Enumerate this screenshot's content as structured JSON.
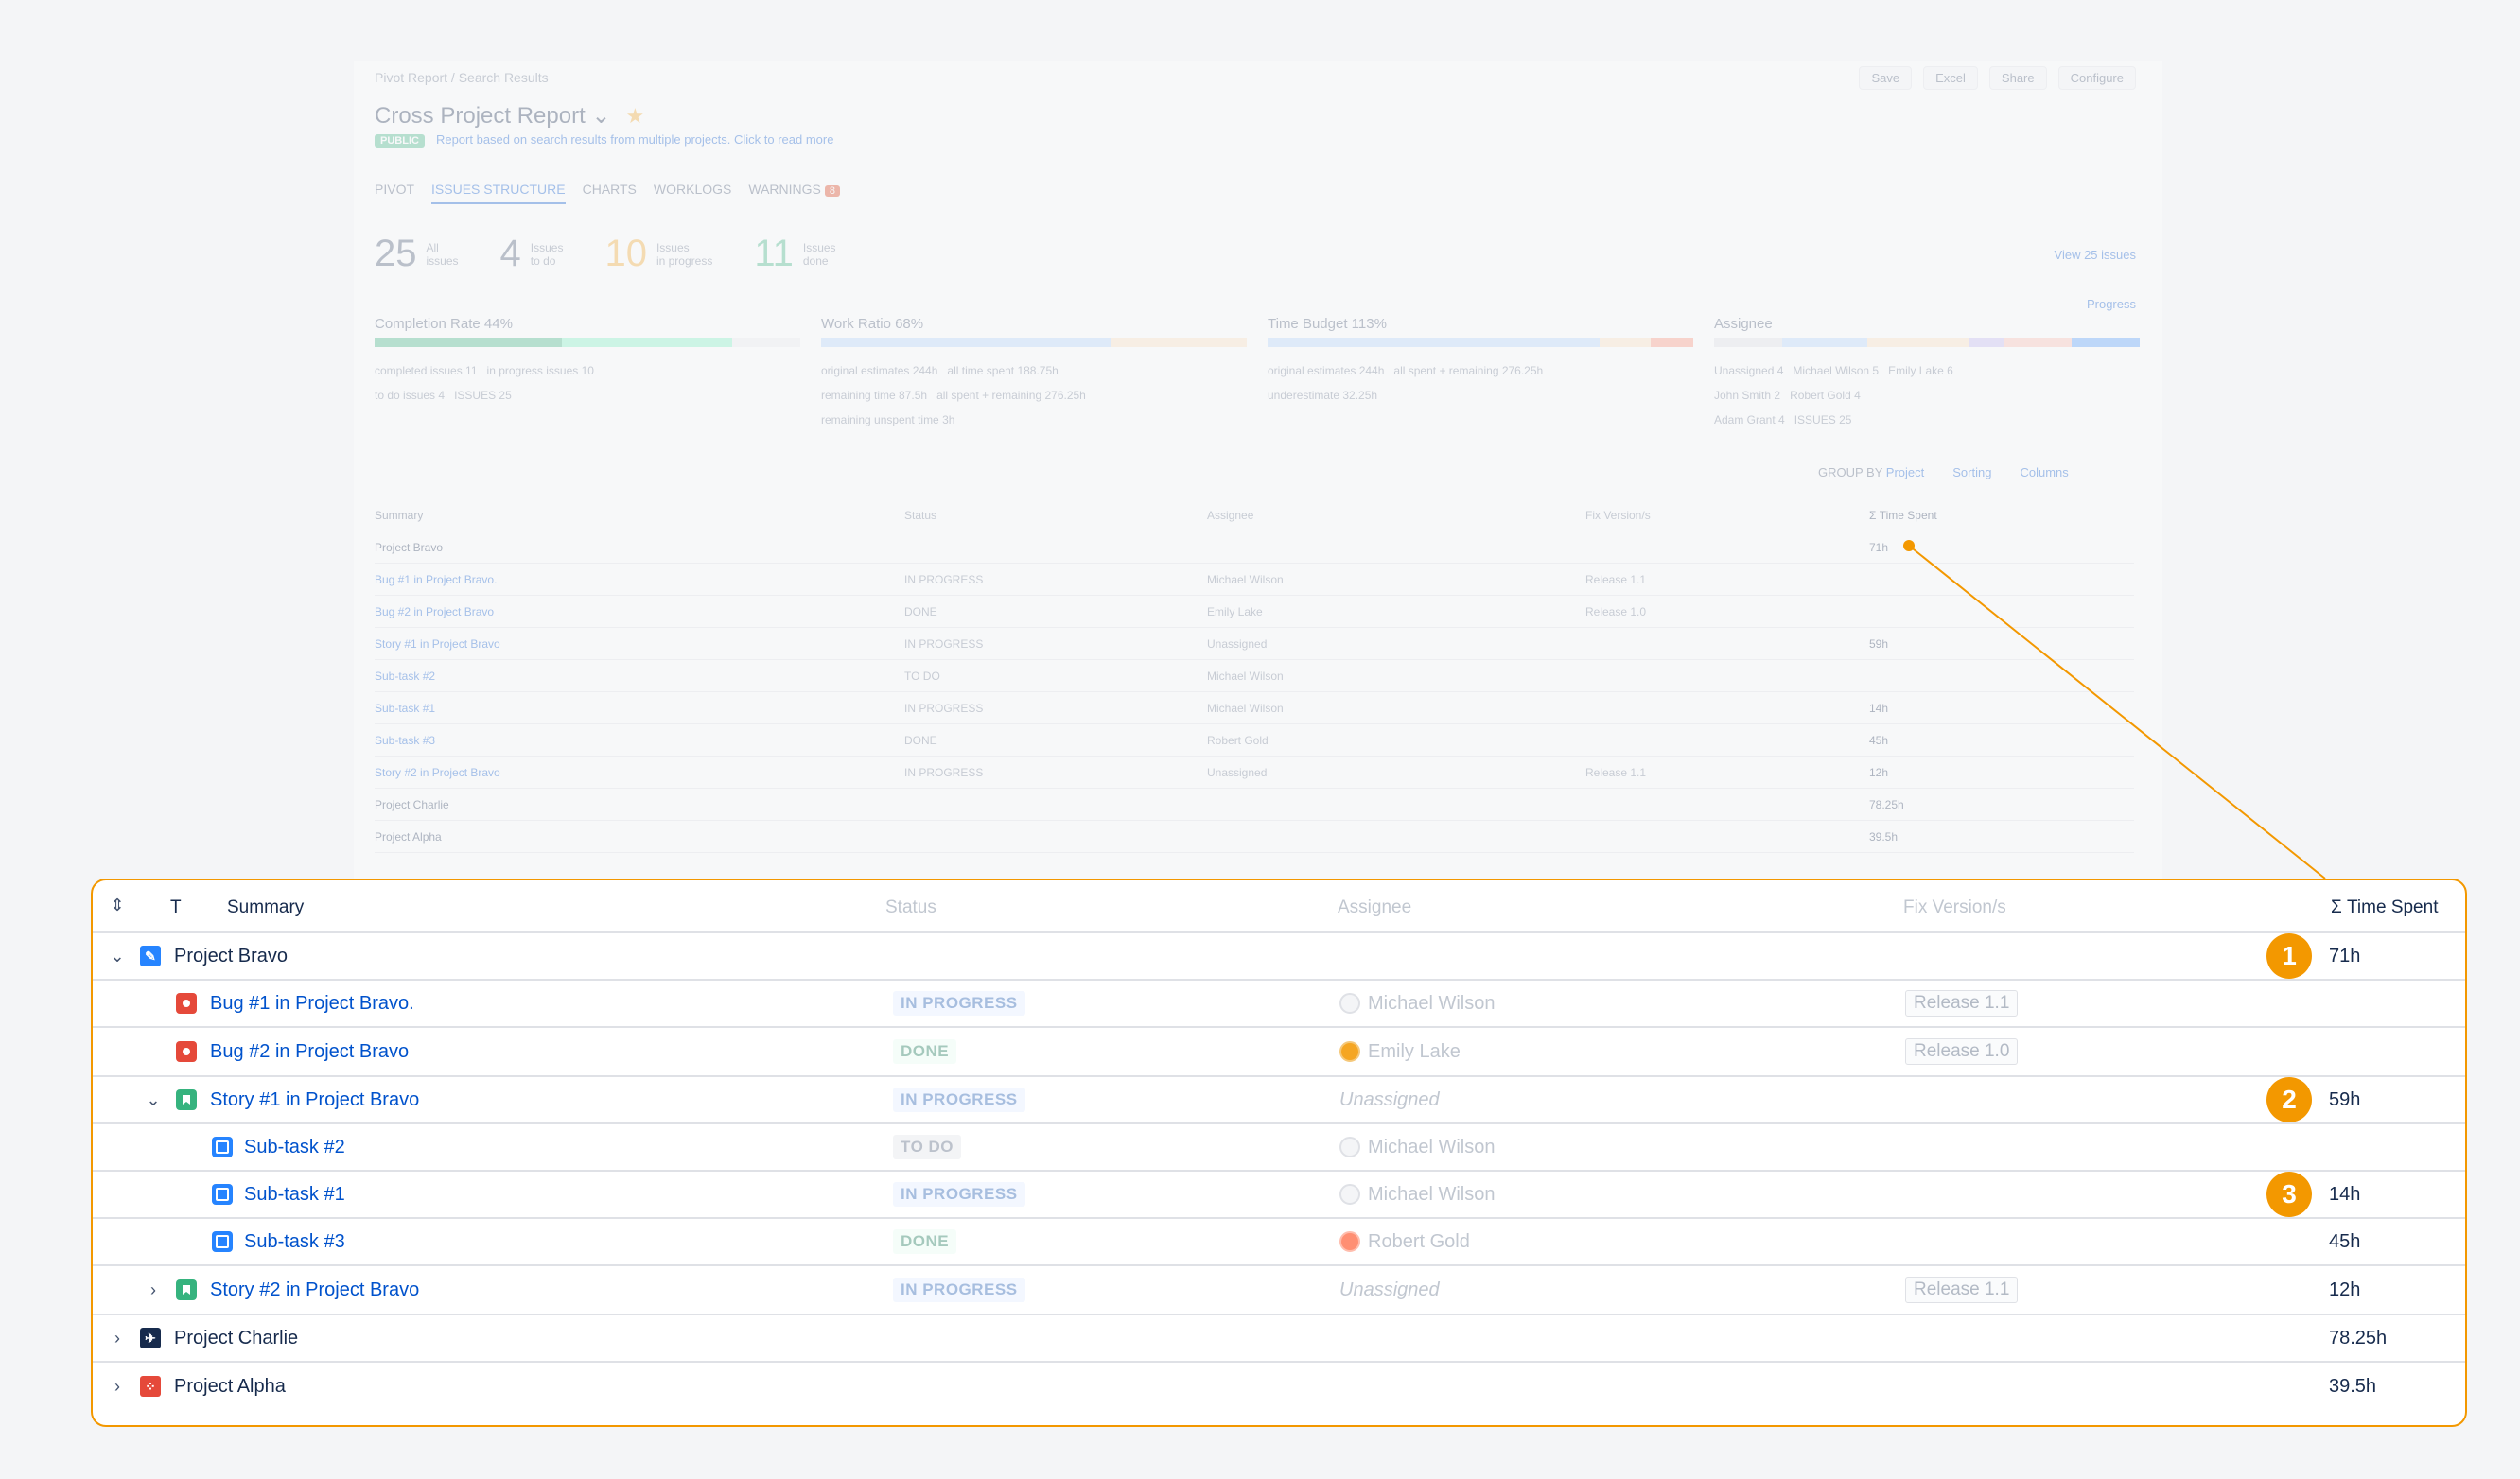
{
  "breadcrumb": "Pivot Report / Search Results",
  "toolbar": {
    "save": "Save",
    "excel": "Excel",
    "share": "Share",
    "configure": "Configure"
  },
  "title": "Cross Project Report",
  "public_badge": "PUBLIC",
  "description": "Report based on search results from multiple projects. Click to read more",
  "tabs": [
    "PIVOT",
    "ISSUES STRUCTURE",
    "CHARTS",
    "WORKLOGS",
    "WARNINGS"
  ],
  "warnings_count": "8",
  "stats": [
    {
      "n": "25",
      "l1": "All",
      "l2": "issues"
    },
    {
      "n": "4",
      "l1": "Issues",
      "l2": "to do"
    },
    {
      "n": "10",
      "l1": "Issues",
      "l2": "in progress"
    },
    {
      "n": "11",
      "l1": "Issues",
      "l2": "done"
    }
  ],
  "view_all": "View 25 issues",
  "progress_select": "Progress",
  "panels": {
    "completion": {
      "title": "Completion Rate 44%",
      "legend": [
        "completed issues 11",
        "in progress issues 10",
        "to do issues 4",
        "ISSUES 25"
      ]
    },
    "work_ratio": {
      "title": "Work Ratio 68%",
      "legend": [
        "original estimates 244h",
        "all time spent 188.75h",
        "remaining time 87.5h",
        "all spent + remaining 276.25h",
        "remaining unspent time 3h"
      ]
    },
    "time_budget": {
      "title": "Time Budget 113%",
      "legend": [
        "original estimates 244h",
        "all spent + remaining 276.25h",
        "underestimate 32.25h"
      ]
    },
    "assignee": {
      "title": "Assignee",
      "legend": [
        "Unassigned 4",
        "Michael Wilson 5",
        "Emily Lake 6",
        "John Smith 2",
        "Robert Gold 4",
        "Adam Grant 4",
        "ISSUES 25"
      ]
    }
  },
  "group_by": {
    "label": "GROUP BY",
    "value": "Project",
    "sorting": "Sorting",
    "columns": "Columns"
  },
  "headers": {
    "t": "T",
    "summary": "Summary",
    "status": "Status",
    "assignee": "Assignee",
    "fix_version": "Fix Version/s",
    "time_spent": "Σ Time Spent"
  },
  "rows": [
    {
      "summary": "Project Bravo",
      "status": "",
      "assignee": "",
      "fix": "",
      "time": "71h",
      "badge": "1"
    },
    {
      "summary": "Bug #1 in Project Bravo.",
      "status": "IN PROGRESS",
      "assignee": "Michael Wilson",
      "fix": "Release 1.1",
      "time": ""
    },
    {
      "summary": "Bug #2 in Project Bravo",
      "status": "DONE",
      "assignee": "Emily Lake",
      "fix": "Release 1.0",
      "time": ""
    },
    {
      "summary": "Story #1 in Project Bravo",
      "status": "IN PROGRESS",
      "assignee": "Unassigned",
      "fix": "",
      "time": "59h",
      "badge": "2"
    },
    {
      "summary": "Sub-task #2",
      "status": "TO DO",
      "assignee": "Michael Wilson",
      "fix": "",
      "time": ""
    },
    {
      "summary": "Sub-task #1",
      "status": "IN PROGRESS",
      "assignee": "Michael Wilson",
      "fix": "",
      "time": "14h",
      "badge": "3"
    },
    {
      "summary": "Sub-task #3",
      "status": "DONE",
      "assignee": "Robert Gold",
      "fix": "",
      "time": "45h"
    },
    {
      "summary": "Story #2 in Project Bravo",
      "status": "IN PROGRESS",
      "assignee": "Unassigned",
      "fix": "Release 1.1",
      "time": "12h"
    },
    {
      "summary": "Project Charlie",
      "status": "",
      "assignee": "",
      "fix": "",
      "time": "78.25h"
    },
    {
      "summary": "Project Alpha",
      "status": "",
      "assignee": "",
      "fix": "",
      "time": "39.5h"
    }
  ],
  "colors": {
    "accent": "#0052cc",
    "callout": "#f39800",
    "bug": "#e5493a",
    "story": "#36b37e",
    "subtask": "#2684ff"
  }
}
